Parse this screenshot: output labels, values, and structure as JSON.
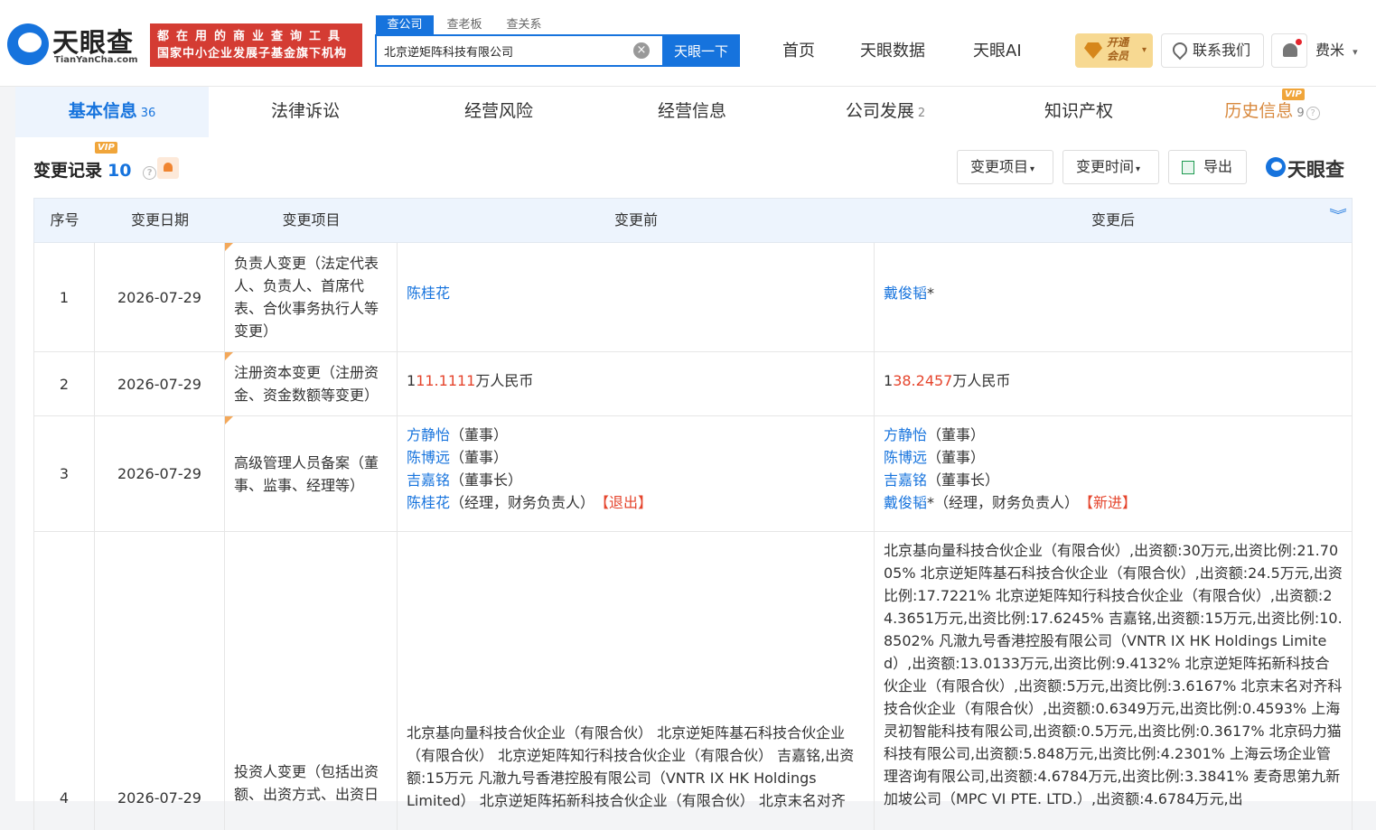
{
  "header": {
    "logo_text": "天眼查",
    "logo_sub": "TianYanCha.com",
    "slogan_line1": "都在用的商业查询工具",
    "slogan_line2": "国家中小企业发展子基金旗下机构",
    "search_tabs": [
      "查公司",
      "查老板",
      "查关系"
    ],
    "search_value": "北京逆矩阵科技有限公司",
    "clear_glyph": "×",
    "search_button": "天眼一下",
    "nav": [
      "首页",
      "天眼数据",
      "天眼AI"
    ],
    "vip_line1": "开通",
    "vip_line2": "会员",
    "contact": "联系我们",
    "user": "费米",
    "caret": "▾"
  },
  "tabs": [
    {
      "label": "基本信息",
      "count": "36"
    },
    {
      "label": "法律诉讼",
      "count": ""
    },
    {
      "label": "经营风险",
      "count": ""
    },
    {
      "label": "经营信息",
      "count": ""
    },
    {
      "label": "公司发展",
      "count": "2"
    },
    {
      "label": "知识产权",
      "count": ""
    },
    {
      "label": "历史信息",
      "count": "9"
    }
  ],
  "vip_label": "VIP",
  "help_glyph": "?",
  "section": {
    "title": "变更记录",
    "count": "10",
    "filter1": "变更项目",
    "filter2": "变更时间",
    "export": "导出",
    "watermark": "天眼查"
  },
  "table": {
    "headers": [
      "序号",
      "变更日期",
      "变更项目",
      "变更前",
      "变更后"
    ],
    "collapse_glyph": "︾",
    "rows": [
      {
        "no": "1",
        "date": "2026-07-29",
        "item": "负责人变更（法定代表人、负责人、首席代表、合伙事务执行人等变更）",
        "before": "陈桂花",
        "after_name": "戴俊韬",
        "after_suffix": "*"
      },
      {
        "no": "2",
        "date": "2026-07-29",
        "item": "注册资本变更（注册资金、资金数额等变更）",
        "before_a": "1",
        "before_b": "11.1111",
        "before_c": "万人民币",
        "after_a": "1",
        "after_b": "38.2457",
        "after_c": "万人民币"
      },
      {
        "no": "3",
        "date": "2026-07-29",
        "item": "高级管理人员备案（董事、监事、经理等）",
        "before": [
          {
            "name": "方静怡",
            "role": "（董事）",
            "tag": ""
          },
          {
            "name": "陈博远",
            "role": "（董事）",
            "tag": ""
          },
          {
            "name": "吉嘉铭",
            "role": "（董事长）",
            "tag": ""
          },
          {
            "name": "陈桂花",
            "role": "（经理，财务负责人）",
            "tag": "【退出】"
          }
        ],
        "after": [
          {
            "name": "方静怡",
            "role": "（董事）",
            "tag": ""
          },
          {
            "name": "陈博远",
            "role": "（董事）",
            "tag": ""
          },
          {
            "name": "吉嘉铭",
            "role": "（董事长）",
            "tag": ""
          },
          {
            "name": "戴俊韬",
            "role": "*（经理，财务负责人）",
            "tag": "【新进】"
          }
        ]
      },
      {
        "no": "4",
        "date": "2026-07-29",
        "item": "投资人变更（包括出资额、出资方式、出资日",
        "before": "北京基向量科技合伙企业（有限合伙） 北京逆矩阵基石科技合伙企业（有限合伙） 北京逆矩阵知行科技合伙企业（有限合伙） 吉嘉铭,出资额:15万元 凡澈九号香港控股有限公司（VNTR IX HK Holdings Limited） 北京逆矩阵拓新科技合伙企业（有限合伙） 北京末名对齐",
        "after": "北京基向量科技合伙企业（有限合伙）,出资额:30万元,出资比例:21.7005% 北京逆矩阵基石科技合伙企业（有限合伙）,出资额:24.5万元,出资比例:17.7221% 北京逆矩阵知行科技合伙企业（有限合伙）,出资额:24.3651万元,出资比例:17.6245% 吉嘉铭,出资额:15万元,出资比例:10.8502% 凡澈九号香港控股有限公司（VNTR IX HK Holdings Limited）,出资额:13.0133万元,出资比例:9.4132% 北京逆矩阵拓新科技合伙企业（有限合伙）,出资额:5万元,出资比例:3.6167% 北京末名对齐科技合伙企业（有限合伙）,出资额:0.6349万元,出资比例:0.4593% 上海灵初智能科技有限公司,出资额:0.5万元,出资比例:0.3617% 北京码力猫科技有限公司,出资额:5.848万元,出资比例:4.2301% 上海云场企业管理咨询有限公司,出资额:4.6784万元,出资比例:3.3841% 麦奇思第九新加坡公司（MPC VI PTE. LTD.）,出资额:4.6784万元,出"
      }
    ]
  }
}
